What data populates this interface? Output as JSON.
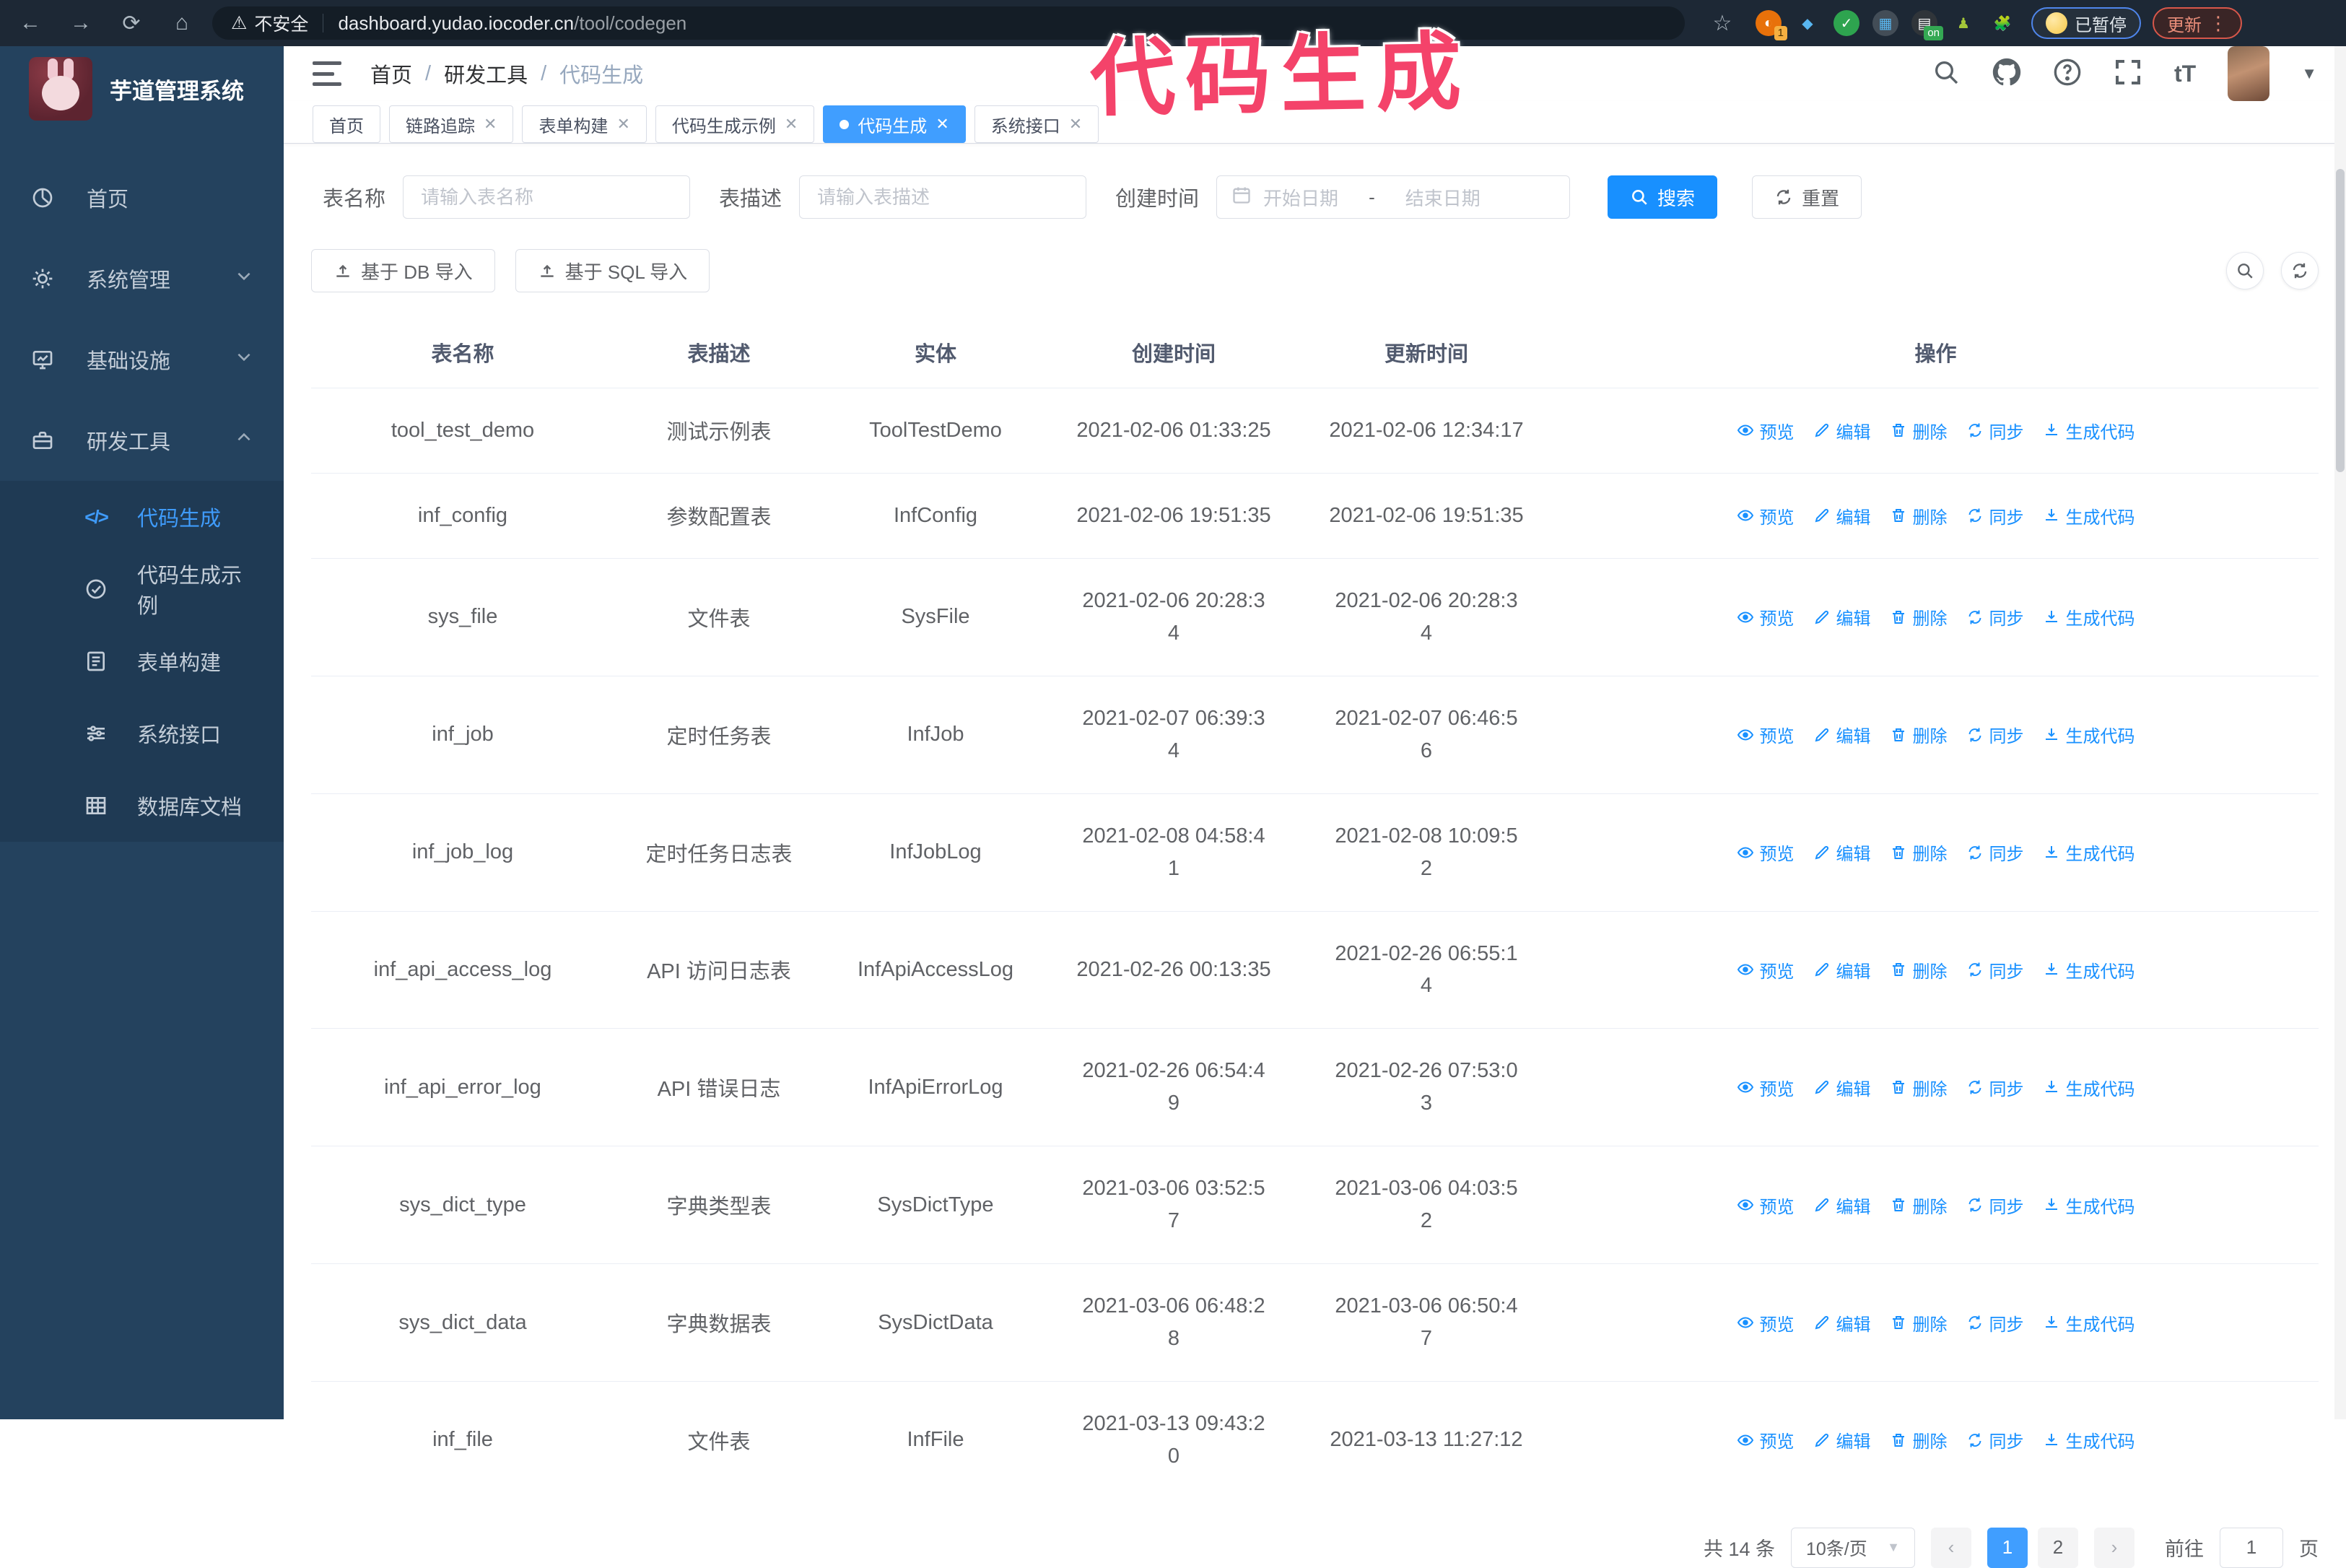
{
  "annotation": {
    "text": "代码生成",
    "color": "#f4436a"
  },
  "browser": {
    "security_label": "不安全",
    "url_domain": "dashboard.yudao.iocoder.cn",
    "url_path": "/tool/codegen",
    "ext_badge_count": "1",
    "ext_badge_on": "on",
    "paused_label": "已暂停",
    "update_label": "更新"
  },
  "sidebar": {
    "title": "芋道管理系统",
    "items": [
      {
        "label": "首页",
        "icon": "dashboard-icon",
        "chevron": "",
        "active": false
      },
      {
        "label": "系统管理",
        "icon": "gear-icon",
        "chevron": "down",
        "active": false
      },
      {
        "label": "基础设施",
        "icon": "infra-icon",
        "chevron": "down",
        "active": false
      },
      {
        "label": "研发工具",
        "icon": "tools-icon",
        "chevron": "up",
        "active": false
      }
    ],
    "submenu": [
      {
        "label": "代码生成",
        "icon": "code-icon",
        "active": true
      },
      {
        "label": "代码生成示例",
        "icon": "check-circle-icon",
        "active": false
      },
      {
        "label": "表单构建",
        "icon": "form-icon",
        "active": false
      },
      {
        "label": "系统接口",
        "icon": "sliders-icon",
        "active": false
      },
      {
        "label": "数据库文档",
        "icon": "database-icon",
        "active": false
      }
    ]
  },
  "header": {
    "breadcrumb": [
      "首页",
      "研发工具",
      "代码生成"
    ]
  },
  "tabs": [
    {
      "label": "首页",
      "closable": false,
      "active": false
    },
    {
      "label": "链路追踪",
      "closable": true,
      "active": false
    },
    {
      "label": "表单构建",
      "closable": true,
      "active": false
    },
    {
      "label": "代码生成示例",
      "closable": true,
      "active": false
    },
    {
      "label": "代码生成",
      "closable": true,
      "active": true
    },
    {
      "label": "系统接口",
      "closable": true,
      "active": false
    }
  ],
  "search": {
    "name_label": "表名称",
    "name_placeholder": "请输入表名称",
    "desc_label": "表描述",
    "desc_placeholder": "请输入表描述",
    "time_label": "创建时间",
    "start_placeholder": "开始日期",
    "range_separator": "-",
    "end_placeholder": "结束日期",
    "search_label": "搜索",
    "reset_label": "重置"
  },
  "toolbar": {
    "import_db_label": "基于 DB 导入",
    "import_sql_label": "基于 SQL 导入"
  },
  "table": {
    "headers": [
      "表名称",
      "表描述",
      "实体",
      "创建时间",
      "更新时间",
      "操作"
    ],
    "actions": [
      {
        "icon": "eye-icon",
        "label": "预览"
      },
      {
        "icon": "edit-icon",
        "label": "编辑"
      },
      {
        "icon": "trash-icon",
        "label": "删除"
      },
      {
        "icon": "sync-icon",
        "label": "同步"
      },
      {
        "icon": "download-icon",
        "label": "生成代码"
      }
    ],
    "rows": [
      {
        "name": "tool_test_demo",
        "desc": "测试示例表",
        "entity": "ToolTestDemo",
        "created": "2021-02-06 01:33:25",
        "updated": "2021-02-06 12:34:17"
      },
      {
        "name": "inf_config",
        "desc": "参数配置表",
        "entity": "InfConfig",
        "created": "2021-02-06 19:51:35",
        "updated": "2021-02-06 19:51:35"
      },
      {
        "name": "sys_file",
        "desc": "文件表",
        "entity": "SysFile",
        "created": "2021-02-06 20:28:3\n4",
        "updated": "2021-02-06 20:28:3\n4"
      },
      {
        "name": "inf_job",
        "desc": "定时任务表",
        "entity": "InfJob",
        "created": "2021-02-07 06:39:3\n4",
        "updated": "2021-02-07 06:46:5\n6"
      },
      {
        "name": "inf_job_log",
        "desc": "定时任务日志表",
        "entity": "InfJobLog",
        "created": "2021-02-08 04:58:4\n1",
        "updated": "2021-02-08 10:09:5\n2"
      },
      {
        "name": "inf_api_access_log",
        "desc": "API 访问日志表",
        "entity": "InfApiAccessLog",
        "created": "2021-02-26 00:13:35",
        "updated": "2021-02-26 06:55:1\n4"
      },
      {
        "name": "inf_api_error_log",
        "desc": "API 错误日志",
        "entity": "InfApiErrorLog",
        "created": "2021-02-26 06:54:4\n9",
        "updated": "2021-02-26 07:53:0\n3"
      },
      {
        "name": "sys_dict_type",
        "desc": "字典类型表",
        "entity": "SysDictType",
        "created": "2021-03-06 03:52:5\n7",
        "updated": "2021-03-06 04:03:5\n2"
      },
      {
        "name": "sys_dict_data",
        "desc": "字典数据表",
        "entity": "SysDictData",
        "created": "2021-03-06 06:48:2\n8",
        "updated": "2021-03-06 06:50:4\n7"
      },
      {
        "name": "inf_file",
        "desc": "文件表",
        "entity": "InfFile",
        "created": "2021-03-13 09:43:2\n0",
        "updated": "2021-03-13 11:27:12"
      }
    ]
  },
  "pagination": {
    "total_label": "共 14 条",
    "page_size_label": "10条/页",
    "pages": [
      "1",
      "2"
    ],
    "active_page": "1",
    "goto_label": "前往",
    "goto_value": "1",
    "page_unit": "页"
  },
  "colors": {
    "accent": "#1890ff",
    "tab_active": "#409eff",
    "sidebar_bg": "#24425e",
    "submenu_bg": "#1f3a54",
    "annotation": "#f4436a"
  }
}
